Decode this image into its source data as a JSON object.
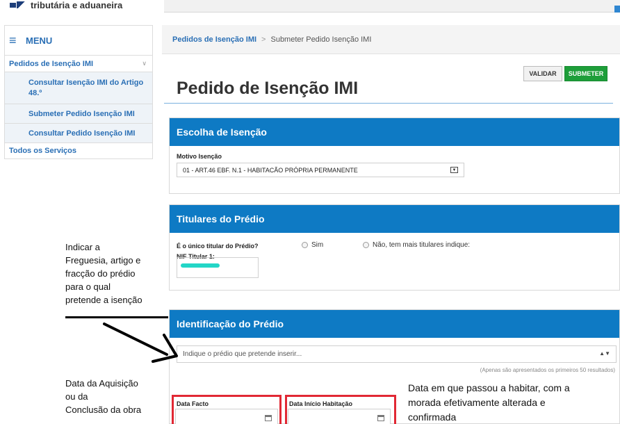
{
  "header": {
    "brand_text": "tributária e aduaneira"
  },
  "sidebar": {
    "menu_label": "MENU",
    "group_label": "Pedidos de Isenção IMI",
    "sub_items": [
      {
        "label": "Consultar Isenção IMI do Artigo 48.º"
      },
      {
        "label": "Submeter Pedido Isenção IMI"
      },
      {
        "label": "Consultar Pedido Isenção IMI"
      }
    ],
    "all_services": "Todos os Serviços"
  },
  "breadcrumb": {
    "link": "Pedidos de Isenção IMI",
    "separator": ">",
    "current": "Submeter Pedido Isenção IMI"
  },
  "page": {
    "title": "Pedido de Isenção IMI"
  },
  "buttons": {
    "validar": "VALIDAR",
    "submeter": "SUBMETER"
  },
  "panel_escolha": {
    "title": "Escolha de Isenção",
    "motivo_label": "Motivo Isenção",
    "motivo_value": "01 - ART.46 EBF. N.1 - HABITACÃO PRÓPRIA PERMANENTE"
  },
  "panel_titulares": {
    "title": "Titulares do Prédio",
    "question": "É o único titular do Prédio?",
    "option_sim": "Sim",
    "option_nao": "Não, tem mais titulares indique:",
    "nif_label": "NIF Titular 1:"
  },
  "panel_identificacao": {
    "title": "Identificação do Prédio",
    "select_placeholder": "Indique o prédio que pretende inserir...",
    "hint": "(Apenas são apresentados os primeiros 50 resultados)",
    "data_facto_label": "Data Facto",
    "data_inicio_label": "Data Início Habitação"
  },
  "annotations": {
    "left_top": [
      "Indicar a",
      "Freguesia, artigo e",
      "fracção do prédio",
      "para o qual",
      "pretende a isenção"
    ],
    "left_bottom": [
      "Data da Aquisição",
      "ou da",
      "Conclusão da obra"
    ],
    "right": [
      "Data em que passou a habitar, com a",
      "morada efetivamente alterada e",
      "confirmada"
    ]
  },
  "colors": {
    "accent_blue": "#0e7ac4",
    "link_blue": "#2a6fb5",
    "submit_green": "#1e9e3a",
    "highlight_red": "#e12834",
    "redaction_cyan": "#23d6c7"
  }
}
